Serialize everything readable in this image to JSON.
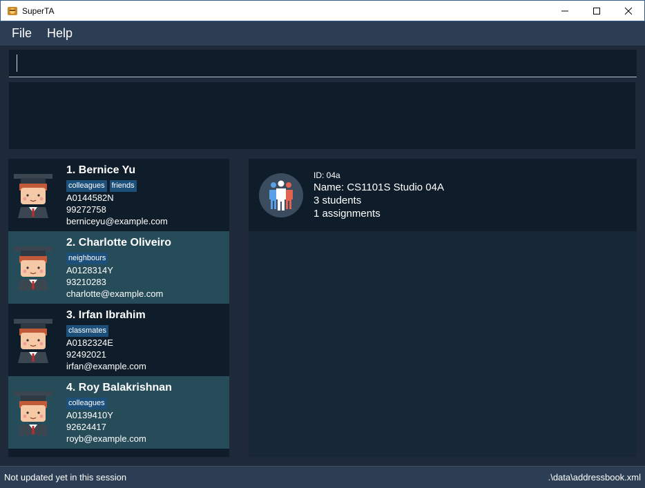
{
  "window": {
    "title": "SuperTA",
    "controls": [
      "minimize",
      "maximize",
      "close"
    ]
  },
  "menu": {
    "items": [
      "File",
      "Help"
    ]
  },
  "command": {
    "value": "",
    "placeholder": ""
  },
  "result": {
    "text": ""
  },
  "persons": [
    {
      "name": "1.  Bernice Yu",
      "tags": [
        "colleagues",
        "friends"
      ],
      "id": "A0144582N",
      "phone": "99272758",
      "email": "berniceyu@example.com"
    },
    {
      "name": "2.  Charlotte Oliveiro",
      "tags": [
        "neighbours"
      ],
      "id": "A0128314Y",
      "phone": "93210283",
      "email": "charlotte@example.com"
    },
    {
      "name": "3.  Irfan Ibrahim",
      "tags": [
        "classmates"
      ],
      "id": "A0182324E",
      "phone": "92492021",
      "email": "irfan@example.com"
    },
    {
      "name": "4.  Roy Balakrishnan",
      "tags": [
        "colleagues"
      ],
      "id": "A0139410Y",
      "phone": "92624417",
      "email": "royb@example.com"
    }
  ],
  "group": {
    "id": "ID: 04a",
    "name": "Name: CS1101S Studio 04A",
    "students": "3 students",
    "assignments": "1 assignments"
  },
  "status": {
    "left": "Not updated yet in this session",
    "right": ".\\data\\addressbook.xml"
  },
  "colors": {
    "background": "#1e2a39",
    "card_dark": "#0f1d2a",
    "card_selected": "#264c5a",
    "tag": "#1c4f7a",
    "menu": "#2c3e53"
  }
}
